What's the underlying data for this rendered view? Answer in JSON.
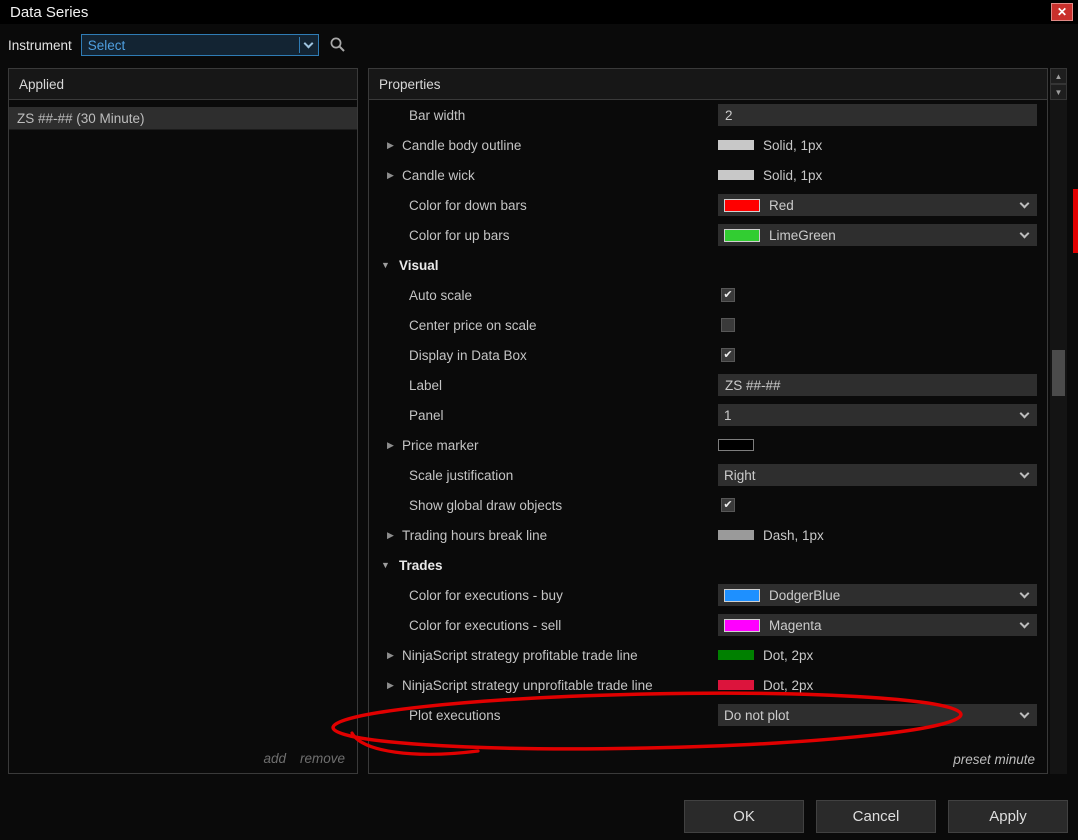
{
  "window": {
    "title": "Data Series",
    "close_glyph": "✕"
  },
  "toolbar": {
    "instrument_label": "Instrument",
    "instrument_value": "Select"
  },
  "applied": {
    "header": "Applied",
    "items": [
      "ZS ##-## (30 Minute)"
    ],
    "add_label": "add",
    "remove_label": "remove"
  },
  "properties": {
    "header": "Properties",
    "preset_label": "preset minute",
    "rows": [
      {
        "label": "Bar width",
        "value": {
          "kind": "textbox",
          "text": "2"
        }
      },
      {
        "label": "Candle body outline",
        "expander": true,
        "value": {
          "kind": "line",
          "swatch": "#c8c8c8",
          "text": "Solid, 1px"
        }
      },
      {
        "label": "Candle wick",
        "expander": true,
        "value": {
          "kind": "line",
          "swatch": "#c8c8c8",
          "text": "Solid, 1px"
        }
      },
      {
        "label": "Color for down bars",
        "value": {
          "kind": "color",
          "swatch": "#ff0000",
          "text": "Red"
        }
      },
      {
        "label": "Color for up bars",
        "value": {
          "kind": "color",
          "swatch": "#32cd32",
          "text": "LimeGreen"
        }
      },
      {
        "label": "Visual",
        "category": true
      },
      {
        "label": "Auto scale",
        "value": {
          "kind": "checkbox",
          "checked": true
        }
      },
      {
        "label": "Center price on scale",
        "value": {
          "kind": "checkbox",
          "checked": false
        }
      },
      {
        "label": "Display in Data Box",
        "value": {
          "kind": "checkbox",
          "checked": true
        }
      },
      {
        "label": "Label",
        "value": {
          "kind": "textbox",
          "text": "ZS ##-##"
        }
      },
      {
        "label": "Panel",
        "value": {
          "kind": "dropdown",
          "text": "1"
        }
      },
      {
        "label": "Price marker",
        "expander": true,
        "value": {
          "kind": "swatch",
          "swatch": "#000000"
        }
      },
      {
        "label": "Scale justification",
        "value": {
          "kind": "dropdown",
          "text": "Right"
        }
      },
      {
        "label": "Show global draw objects",
        "value": {
          "kind": "checkbox",
          "checked": true
        }
      },
      {
        "label": "Trading hours break line",
        "expander": true,
        "value": {
          "kind": "line",
          "swatch": "#9a9a9a",
          "text": "Dash, 1px"
        }
      },
      {
        "label": "Trades",
        "category": true
      },
      {
        "label": "Color for executions - buy",
        "value": {
          "kind": "color",
          "swatch": "#1e90ff",
          "text": "DodgerBlue"
        }
      },
      {
        "label": "Color for executions - sell",
        "value": {
          "kind": "color",
          "swatch": "#ff00ff",
          "text": "Magenta"
        }
      },
      {
        "label": "NinjaScript strategy profitable trade line",
        "expander": true,
        "value": {
          "kind": "line",
          "swatch": "#008000",
          "text": "Dot, 2px"
        }
      },
      {
        "label": "NinjaScript strategy unprofitable trade line",
        "expander": true,
        "value": {
          "kind": "line",
          "swatch": "#dc143c",
          "text": "Dot, 2px"
        }
      },
      {
        "label": "Plot executions",
        "value": {
          "kind": "dropdown",
          "text": "Do not plot"
        }
      }
    ]
  },
  "footer": {
    "ok": "OK",
    "cancel": "Cancel",
    "apply": "Apply"
  },
  "icons": {
    "check": "✔",
    "expander_collapsed": "▶",
    "expander_expanded": "▼",
    "scroll_up": "▲",
    "scroll_down": "▼"
  },
  "annotation": {
    "color": "#e10000"
  }
}
